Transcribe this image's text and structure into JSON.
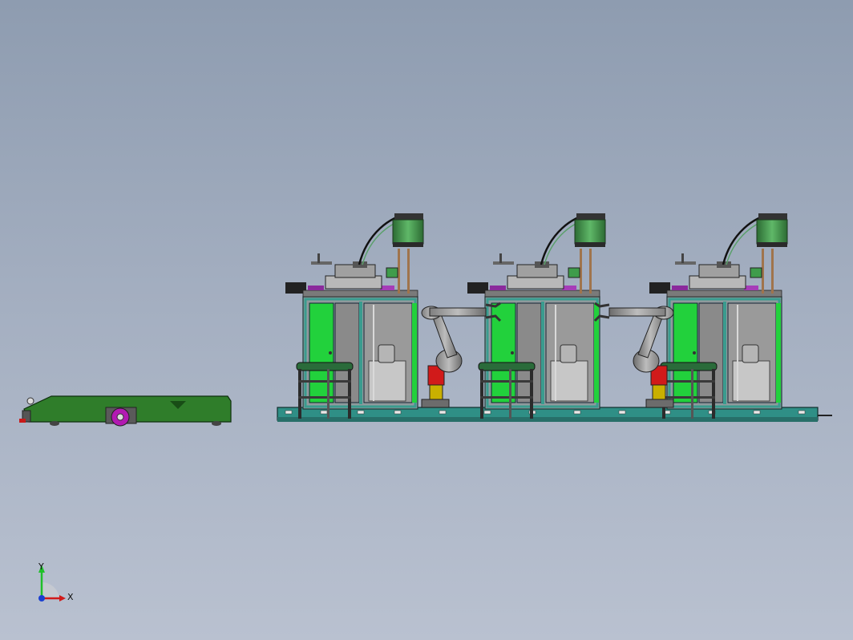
{
  "viewport": {
    "background_top": "#8e9cb0",
    "background_bottom": "#b9c1d0"
  },
  "colors": {
    "base_rail": "#2f8f86",
    "cabinet_frame": "#3a9c8f",
    "door_green": "#22d13c",
    "cabinet_gray": "#8f8f8f",
    "panel_light": "#c7c7c7",
    "accent_purple": "#8a2a9c",
    "robot_red": "#d11a1a",
    "robot_yellow": "#c9b000",
    "motor_green": "#3f9c4b",
    "agv_body": "#2f7d2a",
    "wheel_magenta": "#b21ab2"
  },
  "scene": {
    "agv": {
      "name": "agv-cart"
    },
    "line": {
      "station_count": 3
    }
  },
  "triad": {
    "x_label": "X",
    "y_label": "Y"
  }
}
